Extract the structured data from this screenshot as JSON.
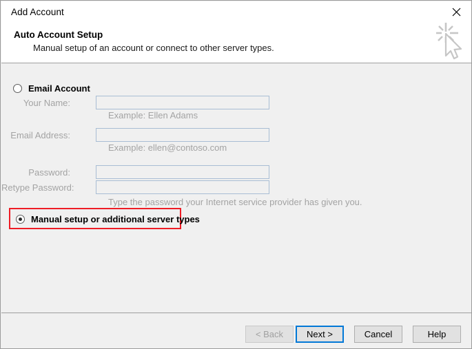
{
  "window": {
    "title": "Add Account",
    "close_icon": "close-icon",
    "decoration_icon": "cursor-sparkle-icon"
  },
  "header": {
    "title": "Auto Account Setup",
    "subtitle": "Manual setup of an account or connect to other server types."
  },
  "options": {
    "email_account": {
      "label": "Email Account",
      "selected": false
    },
    "manual_setup": {
      "label": "Manual setup or additional server types",
      "selected": true,
      "highlight_color": "#ee1c25"
    }
  },
  "fields": {
    "your_name": {
      "label": "Your Name:",
      "value": "",
      "placeholder": "",
      "hint": "Example: Ellen Adams",
      "disabled": true
    },
    "email_address": {
      "label": "Email Address:",
      "value": "",
      "placeholder": "",
      "hint": "Example: ellen@contoso.com",
      "disabled": true
    },
    "password": {
      "label": "Password:",
      "value": "",
      "placeholder": "",
      "disabled": true
    },
    "retype_password": {
      "label": "Retype Password:",
      "value": "",
      "placeholder": "",
      "disabled": true
    },
    "password_hint": "Type the password your Internet service provider has given you."
  },
  "buttons": {
    "back": {
      "label": "< Back",
      "disabled": true
    },
    "next": {
      "label": "Next >",
      "default": true
    },
    "cancel": {
      "label": "Cancel"
    },
    "help": {
      "label": "Help"
    }
  },
  "colors": {
    "dialog_background": "#f0f0f0",
    "header_background": "#ffffff",
    "accent_focus": "#0078d7",
    "highlight": "#ee1c25",
    "field_border": "#a8bdd4",
    "disabled_text": "#a3a3a3"
  }
}
